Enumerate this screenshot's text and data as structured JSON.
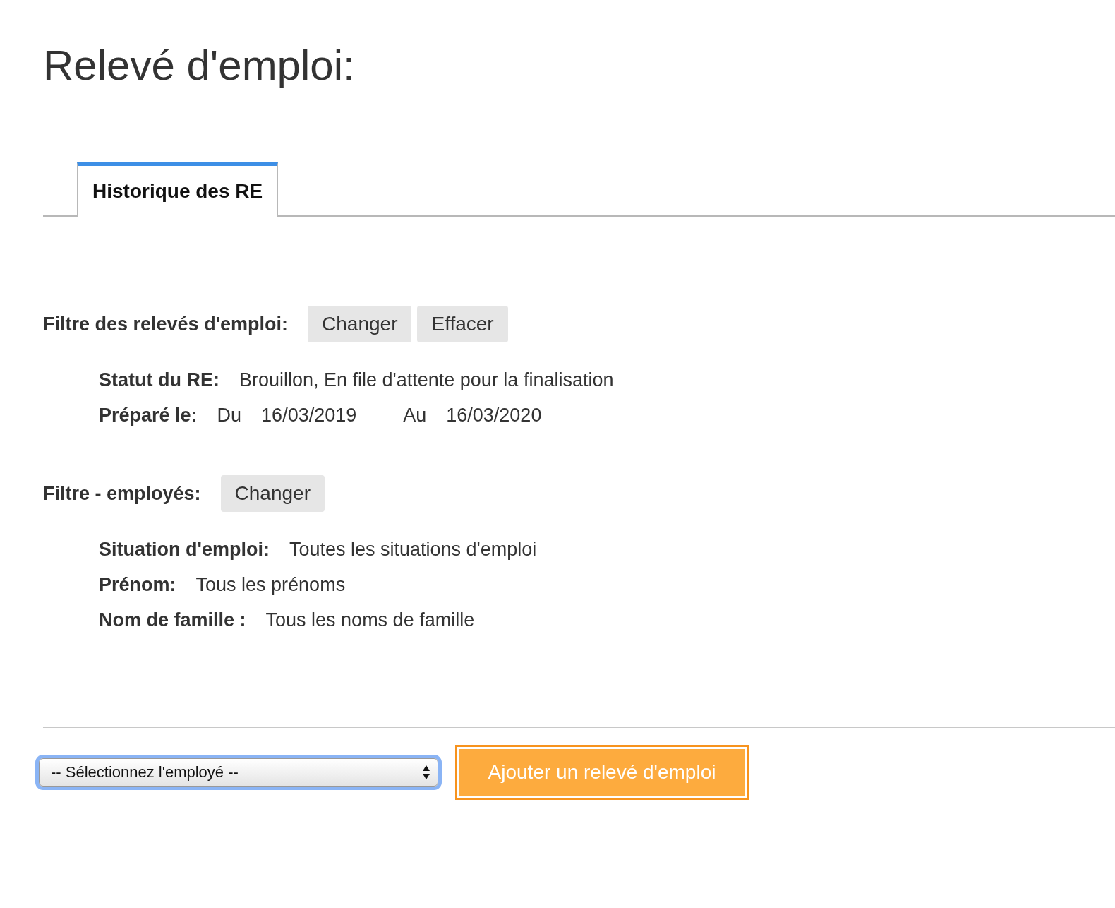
{
  "title": "Relevé d'emploi:",
  "tabs": [
    {
      "label": "Historique des RE",
      "selected": true
    }
  ],
  "filters": [
    {
      "label": "Filtre des relevés d'emploi:",
      "buttons": [
        "Changer",
        "Effacer"
      ],
      "details": [
        {
          "label": "Statut du RE:",
          "values": [
            "Brouillon, En file d'attente pour la finalisation"
          ]
        },
        {
          "label": "Préparé le:",
          "ranges": [
            {
              "prefix": "Du",
              "date": "16/03/2019"
            },
            {
              "prefix": "Au",
              "date": "16/03/2020"
            }
          ]
        }
      ]
    },
    {
      "label": "Filtre - employés:",
      "buttons": [
        "Changer"
      ],
      "details": [
        {
          "label": "Situation d'emploi:",
          "values": [
            "Toutes les situations d'emploi"
          ]
        },
        {
          "label": "Prénom:",
          "values": [
            "Tous les prénoms"
          ]
        },
        {
          "label": "Nom de famille :",
          "values": [
            "Tous les noms de famille"
          ]
        }
      ]
    }
  ],
  "employee_select": {
    "value": "-- Sélectionnez l'employé --",
    "focused": true
  },
  "add_button": {
    "label": "Ajouter un relevé d'emploi",
    "focused": true
  }
}
